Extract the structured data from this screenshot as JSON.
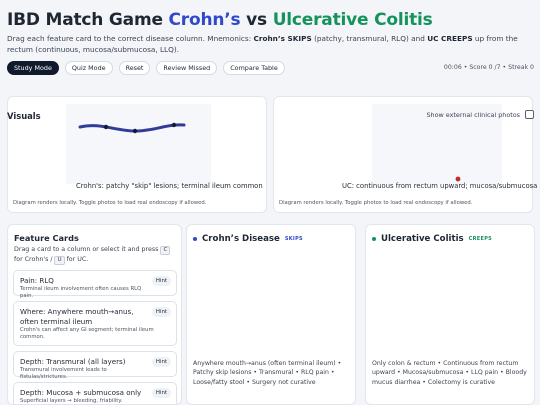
{
  "header": {
    "title_lead": "IBD Match Game ",
    "title_crohn": "Crohn’s",
    "title_vs": " vs ",
    "title_uc": "Ulcerative Colitis",
    "subtitle_1": "Drag each feature card to the correct disease column. Mnemonics: ",
    "subtitle_crohn_mn": "Crohn’s SKIPS",
    "subtitle_2": " (patchy, transmural, RLQ) and ",
    "subtitle_uc_mn": "UC CREEPS",
    "subtitle_3": " up from the rectum (continuous, mucosa/submucosa, LLQ)."
  },
  "toolbar": {
    "buttons": [
      "Study Mode",
      "Quiz Mode",
      "Reset",
      "Review Missed",
      "Compare Table"
    ],
    "active_index": 0
  },
  "status": {
    "text": "00:06 • Score 0 /7 • Streak 0"
  },
  "visuals": {
    "heading": "Visuals",
    "photo_toggle_label": "Show external clinical photos",
    "photo_toggle_checked": false,
    "crohn_caption": "Crohn's: patchy \"skip\" lesions; terminal ileum common",
    "uc_caption": "UC: continuous from rectum upward; mucosa/submucosa",
    "note": "Diagram renders locally. Toggle photos to load real endoscopy if allowed."
  },
  "features": {
    "heading": "Feature Cards",
    "help_1": "Drag a card to a column or select it and press ",
    "key_c": "C",
    "help_2": " for Crohn's / ",
    "key_u": "U",
    "help_3": " for UC.",
    "hint_label": "Hint",
    "cards": [
      {
        "title": "Pain: RLQ",
        "desc": "Terminal ileum involvement often causes RLQ pain."
      },
      {
        "title": "Where: Anywhere mouth→anus, often terminal ileum",
        "desc": "Crohn's can affect any GI segment; terminal ileum common."
      },
      {
        "title": "Depth: Transmural (all layers)",
        "desc": "Transmural involvement leads to fistulas/strictures."
      },
      {
        "title": "Depth: Mucosa + submucosa only",
        "desc": "Superficial layers → bleeding, friability."
      }
    ]
  },
  "columns": {
    "crohn": {
      "name": "Crohn’s Disease",
      "tag": "SKIPS",
      "summary": "Anywhere mouth→anus (often terminal ileum) • Patchy skip lesions • Transmural • RLQ pain • Loose/fatty stool • Surgery not curative"
    },
    "uc": {
      "name": "Ulcerative Colitis",
      "tag": "CREEPS",
      "summary": "Only colon & rectum • Continuous from rectum upward • Mucosa/submucosa • LLQ pain • Bloody mucus diarrhea • Colectomy is curative"
    }
  },
  "colors": {
    "crohn_accent": "#2f49c9",
    "uc_accent": "#14935d",
    "lesion": "#c62828",
    "active_button": "#0f1a2c"
  },
  "icons": {
    "status_dot": "dot-icon"
  }
}
